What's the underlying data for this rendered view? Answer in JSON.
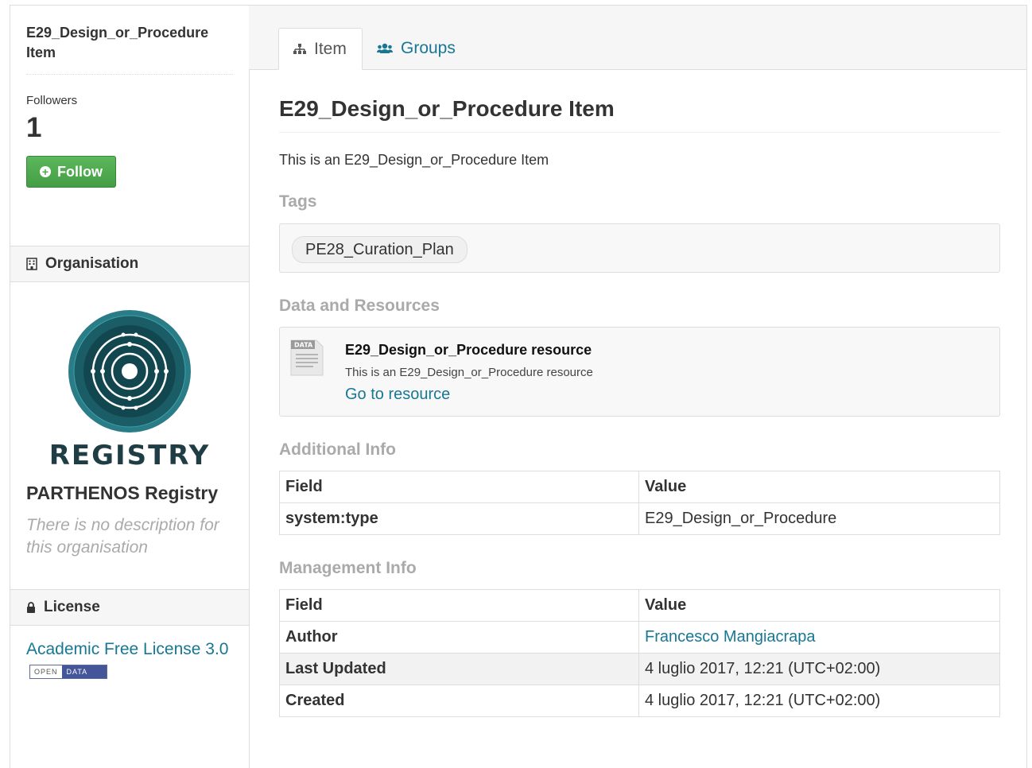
{
  "dataset": {
    "title": "E29_Design_or_Procedure Item",
    "followers_label": "Followers",
    "followers_count": "1",
    "follow_label": "Follow"
  },
  "organisation": {
    "heading": "Organisation",
    "logo_text": "REGISTRY",
    "name": "PARTHENOS Registry",
    "description": "There is no description for this organisation"
  },
  "license": {
    "heading": "License",
    "text": "Academic Free License 3.0",
    "badge_open": "OPEN",
    "badge_data": "DATA"
  },
  "tabs": [
    {
      "label": "Item",
      "icon": "sitemap-icon"
    },
    {
      "label": "Groups",
      "icon": "users-icon"
    }
  ],
  "main": {
    "title": "E29_Design_or_Procedure Item",
    "notes": "This is an E29_Design_or_Procedure Item",
    "tags_heading": "Tags",
    "tags": [
      "PE28_Curation_Plan"
    ],
    "resources_heading": "Data and Resources",
    "resource": {
      "icon_label": "DATA",
      "title": "E29_Design_or_Procedure resource",
      "description": "This is an E29_Design_or_Procedure resource",
      "link": "Go to resource"
    },
    "additional_heading": "Additional Info",
    "additional": {
      "headers": [
        "Field",
        "Value"
      ],
      "rows": [
        [
          "system:type",
          "E29_Design_or_Procedure"
        ]
      ]
    },
    "management_heading": "Management Info",
    "management": {
      "headers": [
        "Field",
        "Value"
      ],
      "rows": [
        [
          "Author",
          "Francesco Mangiacrapa"
        ],
        [
          "Last Updated",
          "4 luglio 2017, 12:21 (UTC+02:00)"
        ],
        [
          "Created",
          "4 luglio 2017, 12:21 (UTC+02:00)"
        ]
      ]
    }
  },
  "colors": {
    "link": "#187794",
    "follow_button": "#5cb85c",
    "heading_muted": "#aaaaaa",
    "logo_teal": "#1f6f7a"
  }
}
